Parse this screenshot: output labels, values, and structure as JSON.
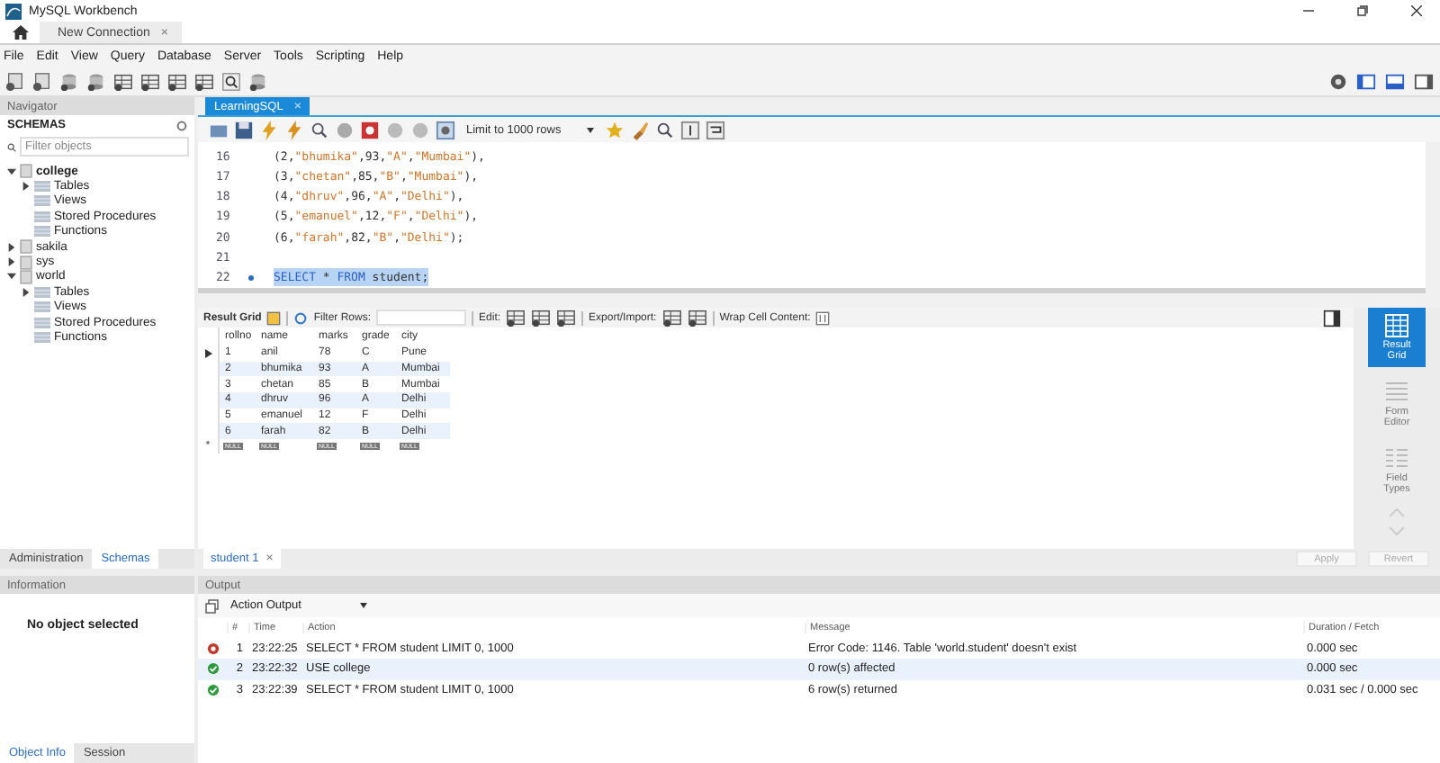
{
  "window": {
    "title": "MySQL Workbench"
  },
  "connection_tabs": [
    {
      "label": "New Connection",
      "close": "×",
      "selected": true
    }
  ],
  "menu": [
    "File",
    "Edit",
    "View",
    "Query",
    "Database",
    "Server",
    "Tools",
    "Scripting",
    "Help"
  ],
  "navigator": {
    "title": "Navigator",
    "section": "SCHEMAS",
    "filter_placeholder": "Filter objects",
    "schemas": [
      {
        "name": "college",
        "expanded": true,
        "default": true,
        "children": [
          {
            "label": "Tables",
            "expandable": true
          },
          {
            "label": "Views",
            "expandable": false
          },
          {
            "label": "Stored Procedures",
            "expandable": false
          },
          {
            "label": "Functions",
            "expandable": false
          }
        ]
      },
      {
        "name": "sakila",
        "expanded": false,
        "default": false
      },
      {
        "name": "sys",
        "expanded": false,
        "default": false
      },
      {
        "name": "world",
        "expanded": true,
        "default": false,
        "children": [
          {
            "label": "Tables",
            "expandable": true
          },
          {
            "label": "Views",
            "expandable": false
          },
          {
            "label": "Stored Procedures",
            "expandable": false
          },
          {
            "label": "Functions",
            "expandable": false
          }
        ]
      }
    ],
    "tabs": [
      {
        "label": "Administration",
        "selected": false
      },
      {
        "label": "Schemas",
        "selected": true
      }
    ]
  },
  "editor": {
    "tab": {
      "label": "LearningSQL",
      "close": "×"
    },
    "limit": "Limit to 1000 rows",
    "lines": [
      {
        "number": "16",
        "text": "(2,\"bhumika\",93,\"A\",\"Mumbai\"),",
        "marker": false,
        "selected": false
      },
      {
        "number": "17",
        "text": "(3,\"chetan\",85,\"B\",\"Mumbai\"),",
        "marker": false,
        "selected": false
      },
      {
        "number": "18",
        "text": "(4,\"dhruv\",96,\"A\",\"Delhi\"),",
        "marker": false,
        "selected": false
      },
      {
        "number": "19",
        "text": "(5,\"emanuel\",12,\"F\",\"Delhi\"),",
        "marker": false,
        "selected": false
      },
      {
        "number": "20",
        "text": "(6,\"farah\",82,\"B\",\"Delhi\");",
        "marker": false,
        "selected": false
      },
      {
        "number": "21",
        "marker": false,
        "selected": false
      },
      {
        "number": "22",
        "text": "SELECT * FROM student;",
        "marker": true,
        "selected": true
      }
    ]
  },
  "results": {
    "toolbar": {
      "grid_label": "Result Grid",
      "filter_label": "Filter Rows:",
      "edit_label": "Edit:",
      "export_label": "Export/Import:",
      "wrap_label": "Wrap Cell Content:"
    },
    "columns": [
      "rollno",
      "name",
      "marks",
      "grade",
      "city"
    ],
    "rows": [
      {
        "cells": [
          "1",
          "anil",
          "78",
          "C",
          "Pune"
        ],
        "current": true
      },
      {
        "cells": [
          "2",
          "bhumika",
          "93",
          "A",
          "Mumbai"
        ],
        "current": false
      },
      {
        "cells": [
          "3",
          "chetan",
          "85",
          "B",
          "Mumbai"
        ],
        "current": false
      },
      {
        "cells": [
          "4",
          "dhruv",
          "96",
          "A",
          "Delhi"
        ],
        "current": false
      },
      {
        "cells": [
          "5",
          "emanuel",
          "12",
          "F",
          "Delhi"
        ],
        "current": false
      },
      {
        "cells": [
          "6",
          "farah",
          "82",
          "B",
          "Delhi"
        ],
        "current": false
      }
    ],
    "new_row": {
      "marker": "*",
      "cells": [
        "NULL",
        "NULL",
        "NULL",
        "NULL",
        "NULL"
      ]
    },
    "side_tabs": [
      {
        "label": "Result Grid",
        "kind": "grid",
        "selected": true
      },
      {
        "label": "Form Editor",
        "kind": "form",
        "selected": false
      },
      {
        "label": "Field Types",
        "kind": "fields",
        "selected": false
      }
    ],
    "result_tab": {
      "label": "student 1",
      "close": "×"
    },
    "buttons": [
      {
        "label": "Apply",
        "disabled": true
      },
      {
        "label": "Revert",
        "disabled": true
      }
    ]
  },
  "information": {
    "title": "Information",
    "message": "No object selected",
    "tabs": [
      {
        "label": "Object Info",
        "selected": true
      },
      {
        "label": "Session",
        "selected": false
      }
    ]
  },
  "output": {
    "title": "Output",
    "selector": "Action Output",
    "columns": [
      "#",
      "Time",
      "Action",
      "Message",
      "Duration / Fetch"
    ],
    "rows": [
      {
        "kind": "error",
        "number": "1",
        "time": "23:22:25",
        "action": "SELECT * FROM student LIMIT 0, 1000",
        "message": "Error Code: 1146. Table 'world.student' doesn't exist",
        "duration": "0.000 sec"
      },
      {
        "kind": "ok",
        "number": "2",
        "time": "23:22:32",
        "action": "USE college",
        "message": "0 row(s) affected",
        "duration": "0.000 sec"
      },
      {
        "kind": "ok",
        "number": "3",
        "time": "23:22:39",
        "action": "SELECT * FROM student LIMIT 0, 1000",
        "message": "6 row(s) returned",
        "duration": "0.031 sec / 0.000 sec"
      }
    ]
  }
}
